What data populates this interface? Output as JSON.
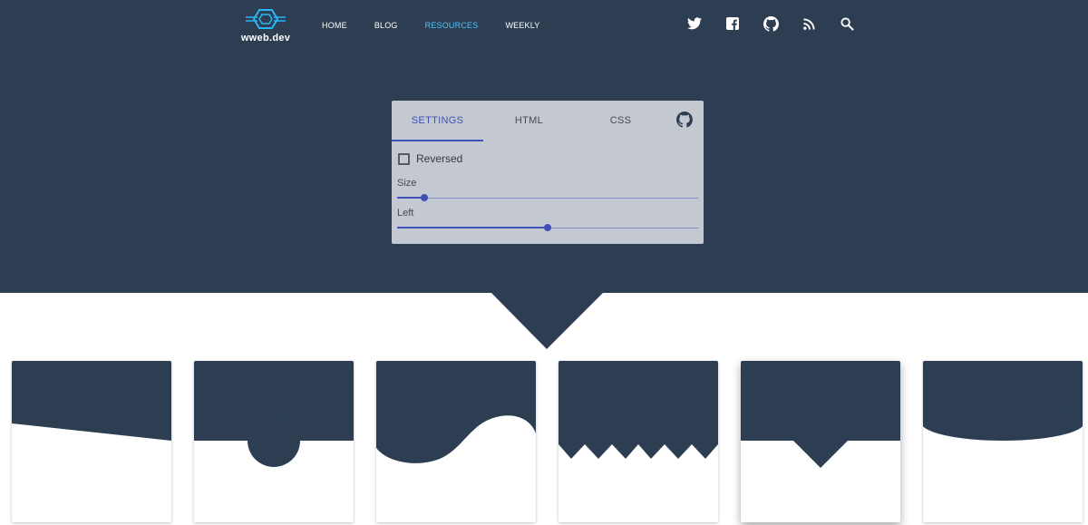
{
  "brand": {
    "name": "wweb.dev"
  },
  "nav": {
    "items": [
      {
        "label": "HOME",
        "active": false
      },
      {
        "label": "BLOG",
        "active": false
      },
      {
        "label": "RESOURCES",
        "active": true
      },
      {
        "label": "WEEKLY",
        "active": false
      }
    ]
  },
  "social": [
    "twitter-icon",
    "facebook-icon",
    "github-icon",
    "rss-icon",
    "search-icon"
  ],
  "panel": {
    "tabs": [
      {
        "label": "SETTINGS",
        "active": true
      },
      {
        "label": "HTML",
        "active": false
      },
      {
        "label": "CSS",
        "active": false
      }
    ],
    "reversed": {
      "label": "Reversed",
      "checked": false
    },
    "sliders": [
      {
        "label": "Size",
        "value": 0.09
      },
      {
        "label": "Left",
        "value": 0.5
      }
    ]
  },
  "cards": [
    {
      "shape": "slant",
      "selected": false
    },
    {
      "shape": "circle",
      "selected": false
    },
    {
      "shape": "wave",
      "selected": false
    },
    {
      "shape": "zigzag",
      "selected": false
    },
    {
      "shape": "triangle",
      "selected": true
    },
    {
      "shape": "ellipse",
      "selected": false
    }
  ],
  "colors": {
    "dark": "#2d3e52",
    "accent": "#3f51b5",
    "nav_active": "#4fc3f7",
    "panel": "#c4c8d0"
  }
}
